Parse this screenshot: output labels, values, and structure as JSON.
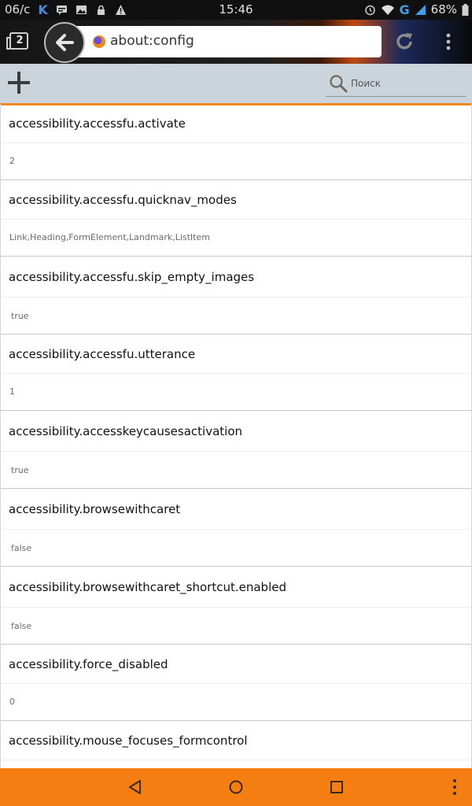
{
  "status_bar": {
    "carrier": "06/c",
    "time": "15:46",
    "battery": "68%",
    "network": "G",
    "icons": [
      "vk-icon",
      "message-icon",
      "image-icon",
      "lock-icon",
      "warning-icon",
      "alarm-icon",
      "wifi-icon",
      "signal-icon",
      "battery-icon"
    ]
  },
  "browser": {
    "tabs_count": "2",
    "url": "about:config"
  },
  "action_bar": {
    "search_placeholder": "Поиск"
  },
  "prefs": [
    {
      "name": "accessibility.accessfu.activate",
      "value": "2"
    },
    {
      "name": "accessibility.accessfu.quicknav_modes",
      "value": "Link,Heading,FormElement,Landmark,ListItem"
    },
    {
      "name": "accessibility.accessfu.skip_empty_images",
      "value": "true"
    },
    {
      "name": "accessibility.accessfu.utterance",
      "value": "1"
    },
    {
      "name": "accessibility.accesskeycausesactivation",
      "value": "true"
    },
    {
      "name": "accessibility.browsewithcaret",
      "value": "false"
    },
    {
      "name": "accessibility.browsewithcaret_shortcut.enabled",
      "value": "false"
    },
    {
      "name": "accessibility.force_disabled",
      "value": "0"
    },
    {
      "name": "accessibility.mouse_focuses_formcontrol",
      "value": ""
    }
  ],
  "colors": {
    "accent": "#f57e12",
    "action_bar": "#cbd3db"
  }
}
